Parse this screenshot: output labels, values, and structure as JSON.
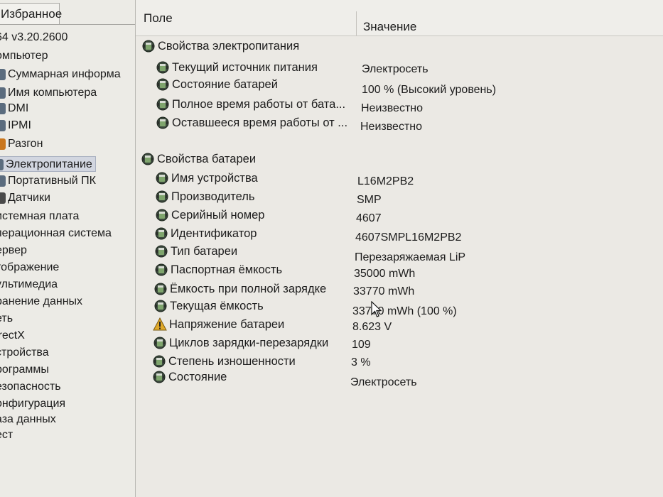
{
  "sidebar": {
    "tab_label": "Избранное",
    "items": [
      {
        "label": "64 v3.20.2600",
        "selected": false,
        "icon": "none"
      },
      {
        "label": "омпьютер",
        "selected": false,
        "icon": "none"
      },
      {
        "label": "Суммарная информа",
        "selected": false,
        "icon": "computer-icon"
      },
      {
        "label": "Имя компьютера",
        "selected": false,
        "icon": "computer-icon"
      },
      {
        "label": "DMI",
        "selected": false,
        "icon": "computer-icon"
      },
      {
        "label": "IPMI",
        "selected": false,
        "icon": "computer-icon"
      },
      {
        "label": "Разгон",
        "selected": false,
        "icon": "flame-icon"
      },
      {
        "label": "Электропитание",
        "selected": true,
        "icon": "power-icon"
      },
      {
        "label": "Портативный ПК",
        "selected": false,
        "icon": "laptop-icon"
      },
      {
        "label": "Датчики",
        "selected": false,
        "icon": "sensor-icon"
      },
      {
        "label": "истемная плата",
        "selected": false,
        "icon": "none"
      },
      {
        "label": "перационная система",
        "selected": false,
        "icon": "none"
      },
      {
        "label": "ервер",
        "selected": false,
        "icon": "none"
      },
      {
        "label": "тображение",
        "selected": false,
        "icon": "none"
      },
      {
        "label": "ультимедиа",
        "selected": false,
        "icon": "none"
      },
      {
        "label": "ранение данных",
        "selected": false,
        "icon": "none"
      },
      {
        "label": "еть",
        "selected": false,
        "icon": "none"
      },
      {
        "label": "irectX",
        "selected": false,
        "icon": "none"
      },
      {
        "label": "стройства",
        "selected": false,
        "icon": "none"
      },
      {
        "label": "рограммы",
        "selected": false,
        "icon": "none"
      },
      {
        "label": "езопасность",
        "selected": false,
        "icon": "none"
      },
      {
        "label": "онфигурация",
        "selected": false,
        "icon": "none"
      },
      {
        "label": "аза данных",
        "selected": false,
        "icon": "none"
      },
      {
        "label": "ест",
        "selected": false,
        "icon": "none"
      }
    ]
  },
  "table": {
    "col_field": "Поле",
    "col_value": "Значение",
    "groups": [
      {
        "title": "Свойства электропитания",
        "rows": [
          {
            "field": "Текущий источник питания",
            "value": "Электросеть",
            "icon": "battery-icon"
          },
          {
            "field": "Состояние батарей",
            "value": "100 % (Высокий уровень)",
            "icon": "battery-icon"
          },
          {
            "field": "Полное время работы от бата...",
            "value": "Неизвестно",
            "icon": "battery-icon"
          },
          {
            "field": "Оставшееся время работы от ...",
            "value": "Неизвестно",
            "icon": "battery-icon"
          }
        ]
      },
      {
        "title": "Свойства батареи",
        "rows": [
          {
            "field": "Имя устройства",
            "value": "L16M2PB2",
            "icon": "battery-icon"
          },
          {
            "field": "Производитель",
            "value": "SMP",
            "icon": "battery-icon"
          },
          {
            "field": "Серийный номер",
            "value": "4607",
            "icon": "battery-icon"
          },
          {
            "field": "Идентификатор",
            "value": "4607SMPL16M2PB2",
            "icon": "battery-icon"
          },
          {
            "field": "Тип батареи",
            "value": "Перезаряжаемая LiP",
            "icon": "battery-icon"
          },
          {
            "field": "Паспортная ёмкость",
            "value": "35000 mWh",
            "icon": "battery-icon"
          },
          {
            "field": "Ёмкость при полной зарядке",
            "value": "33770 mWh",
            "icon": "battery-icon"
          },
          {
            "field": "Текущая ёмкость",
            "value": "33770 mWh  (100 %)",
            "icon": "battery-icon"
          },
          {
            "field": "Напряжение батареи",
            "value": "8.623 V",
            "icon": "warning-icon"
          },
          {
            "field": "Циклов зарядки-перезарядки",
            "value": "109",
            "icon": "battery-icon"
          },
          {
            "field": "Степень изношенности",
            "value": "3 %",
            "icon": "battery-icon"
          },
          {
            "field": "Состояние",
            "value": "Электросеть",
            "icon": "battery-icon"
          }
        ]
      }
    ]
  }
}
